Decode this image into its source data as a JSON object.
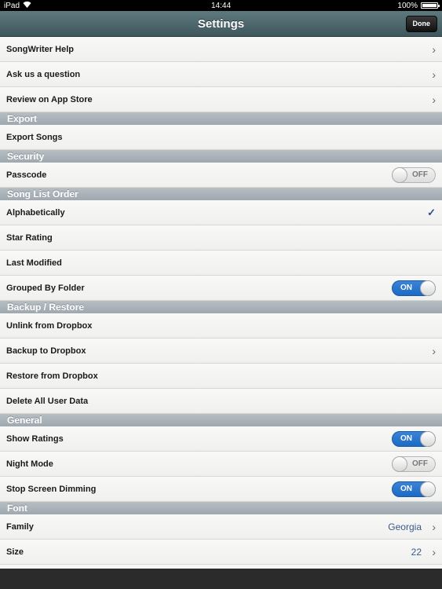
{
  "status_bar": {
    "carrier": "iPad",
    "time": "14:44",
    "battery": "100%"
  },
  "navbar": {
    "title": "Settings",
    "done_label": "Done"
  },
  "icons": {
    "chevron": "›",
    "checkmark": "✓"
  },
  "colors": {
    "nav": "#4f686d",
    "section": "#aab3b9",
    "toggle_on": "#2a76cf",
    "value": "#3b5a8a"
  },
  "help": {
    "songwriter_help": "SongWriter Help",
    "ask_question": "Ask us a question",
    "review": "Review on App Store"
  },
  "export": {
    "header": "Export",
    "export_songs": "Export Songs"
  },
  "security": {
    "header": "Security",
    "passcode": "Passcode",
    "passcode_state": "OFF"
  },
  "song_list_order": {
    "header": "Song List Order",
    "alphabetically": "Alphabetically",
    "star_rating": "Star Rating",
    "last_modified": "Last Modified",
    "grouped_by_folder": "Grouped By Folder",
    "grouped_state": "ON"
  },
  "backup": {
    "header": "Backup / Restore",
    "unlink": "Unlink from Dropbox",
    "backup": "Backup to Dropbox",
    "restore": "Restore from Dropbox",
    "delete": "Delete All User Data"
  },
  "general": {
    "header": "General",
    "show_ratings": "Show Ratings",
    "show_ratings_state": "ON",
    "night_mode": "Night Mode",
    "night_mode_state": "OFF",
    "stop_dimming": "Stop Screen Dimming",
    "stop_dimming_state": "ON"
  },
  "font": {
    "header": "Font",
    "family": "Family",
    "family_value": "Georgia",
    "size": "Size",
    "size_value": "22"
  }
}
